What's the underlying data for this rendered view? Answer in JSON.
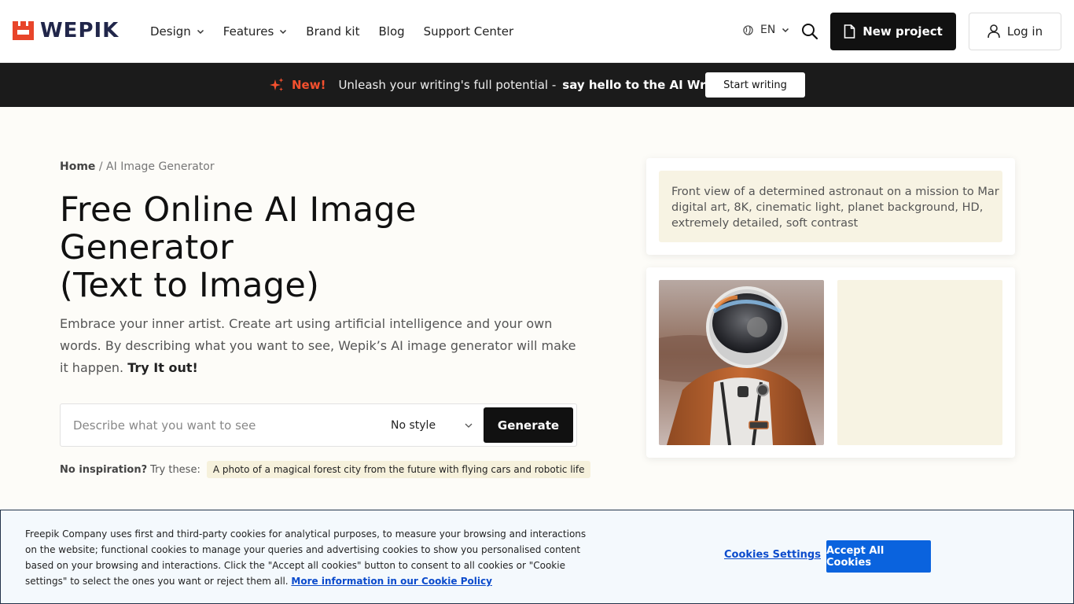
{
  "header": {
    "logo_text": "WEPIK",
    "nav": [
      {
        "label": "Design",
        "has_dropdown": true
      },
      {
        "label": "Features",
        "has_dropdown": true
      },
      {
        "label": "Brand kit",
        "has_dropdown": false
      },
      {
        "label": "Blog",
        "has_dropdown": false
      },
      {
        "label": "Support Center",
        "has_dropdown": false
      }
    ],
    "language": "EN",
    "new_project_label": "New project",
    "login_label": "Log in",
    "icons": {
      "search": "search-icon",
      "globe": "globe-icon",
      "file": "file-icon",
      "user": "user-icon"
    }
  },
  "promo": {
    "new_label": "New!",
    "text": "Unleash your writing's full potential -",
    "bold_text": "say hello to the AI Writer",
    "button_label": "Start writing"
  },
  "hero": {
    "breadcrumb_home": "Home",
    "breadcrumb_separator": "/",
    "breadcrumb_current": "AI Image Generator",
    "title_line1": "Free Online AI Image",
    "title_line2": "Generator",
    "title_line3": "(Text to Image)",
    "description": "Embrace your inner artist. Create art using artificial intelligence and your own words. By describing what you want to see, Wepik’s AI image generator will make it happen.",
    "try_it": "Try It out!"
  },
  "generator": {
    "input_placeholder": "Describe what you want to see",
    "input_value": "",
    "style_selected": "No style",
    "generate_label": "Generate"
  },
  "inspiration": {
    "bold_label": "No inspiration?",
    "label": "Try these:",
    "chip": "A photo of a magical forest city from the future with flying cars and robotic life"
  },
  "example": {
    "prompt_line1": "Front view of a determined astronaut on a mission to Mar",
    "prompt_line2": "digital art, 8K, cinematic light, planet background, HD,",
    "prompt_line3": "extremely detailed, soft contrast"
  },
  "cookie": {
    "text": "Freepik Company uses first and third-party cookies for analytical purposes, to measure your browsing and interactions on the website; functional cookies to manage your queries and advertising cookies to show you personalised content based on your browsing and interactions. Click the \"Accept all cookies\" button to consent to all cookies or \"Cookie settings\" to select the ones you want or reject them all.",
    "link": "More information in our Cookie Policy",
    "settings_label": "Cookies Settings",
    "accept_label": "Accept All Cookies"
  },
  "colors": {
    "brand_red": "#e8452a",
    "brand_navy": "#21264a",
    "promo_new": "#f4502e",
    "accept_blue": "#0a63de",
    "card_cream": "#f7f3e3"
  }
}
